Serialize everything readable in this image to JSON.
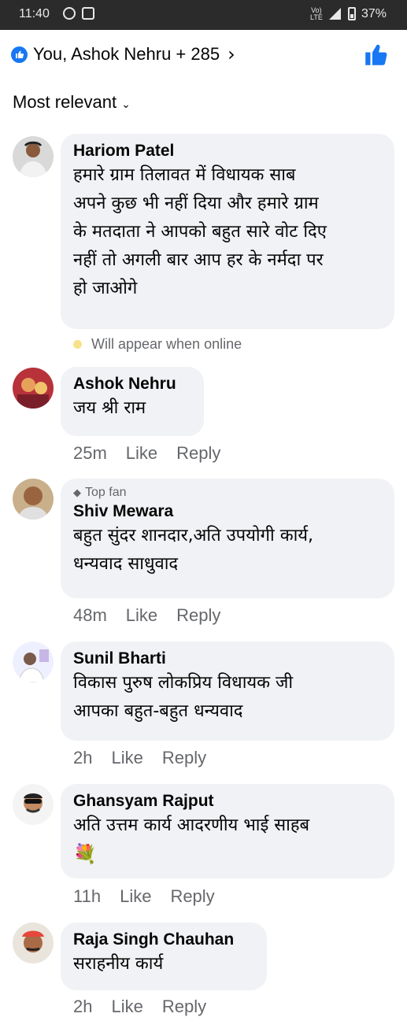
{
  "status_bar": {
    "time": "11:40",
    "network": "Vo) LTE",
    "battery": "37%"
  },
  "reactions": {
    "summary": "You, Ashok Nehru + 285",
    "colors": {
      "accent": "#1877f2"
    }
  },
  "sort": {
    "label": "Most relevant"
  },
  "comments": [
    {
      "author": "Hariom Patel",
      "text": "हमारे ग्राम तिलावत में विधायक साब\nअपने कुछ भी नहीं दिया और हमारे ग्राम\nके मतदाता ने आपको बहुत सारे वोट दिए\nनहीं तो अगली बार आप हर के नर्मदा पर\nहो जाओगे",
      "status": "Will appear when online"
    },
    {
      "author": "Ashok Nehru",
      "text": "जय श्री राम",
      "time": "25m",
      "like": "Like",
      "reply": "Reply"
    },
    {
      "badge": "Top fan",
      "author": "Shiv Mewara",
      "text": "बहुत सुंदर शानदार,अति उपयोगी कार्य,\nधन्यवाद साधुवाद",
      "time": "48m",
      "like": "Like",
      "reply": "Reply"
    },
    {
      "author": "Sunil Bharti",
      "text": "विकास पुरुष लोकप्रिय विधायक जी\nआपका बहुत-बहुत धन्यवाद",
      "time": "2h",
      "like": "Like",
      "reply": "Reply"
    },
    {
      "author": "Ghansyam Rajput",
      "text": "अति उत्तम कार्य आदरणीय भाई साहब",
      "emoji": "💐",
      "time": "11h",
      "like": "Like",
      "reply": "Reply"
    },
    {
      "author": "Raja Singh Chauhan",
      "text": "सराहनीय कार्य",
      "time": "2h",
      "like": "Like",
      "reply": "Reply"
    }
  ]
}
